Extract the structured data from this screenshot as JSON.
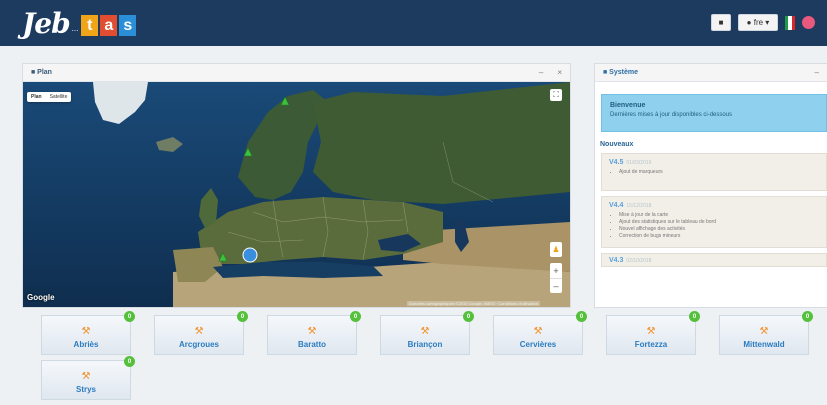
{
  "header": {
    "logo_text": "Jeb",
    "logo_dot": "...",
    "logo_tiles": [
      "t",
      "a",
      "s"
    ],
    "btn_square": "■",
    "btn_lang": "● fre ▾",
    "flag_colors": [
      "#1e9a48",
      "#ffffff",
      "#d6252b"
    ],
    "power_icon": "power-icon"
  },
  "map_panel": {
    "title": "■ Plan",
    "ctrl_minimize": "–",
    "ctrl_close": "×",
    "maptype_plan": "Plan",
    "maptype_sat": "Satellite",
    "fullscreen_icon": "⛶",
    "pegman_icon": "♟",
    "zoom_in": "+",
    "zoom_out": "–",
    "google_label": "Google",
    "attribution": "Données cartographiques ©2019 Google, INEGI · Conditions d'utilisation"
  },
  "side_panel": {
    "title": "■ Système",
    "collapse_icon": "–",
    "info_title": "Bienvenue",
    "info_text": "Dernières mises à jour disponibles ci-dessous",
    "news_title": "Nouveaux",
    "versions": [
      {
        "label": "V4.5",
        "date": "01/03/2019",
        "items": [
          "Ajout de marqueurs"
        ]
      },
      {
        "label": "V4.4",
        "date": "15/12/2018",
        "items": [
          "Mise à jour de la carte",
          "Ajout des statistiques sur le tableau de bord",
          "Nouvel affichage des activités",
          "Correction de bugs mineurs"
        ]
      },
      {
        "label": "V4.3",
        "date": "02/10/2018",
        "items": []
      }
    ]
  },
  "activities": [
    {
      "label": "Abriès",
      "badge": "0"
    },
    {
      "label": "Arcgroues",
      "badge": "0"
    },
    {
      "label": "Baratto",
      "badge": "0"
    },
    {
      "label": "Briançon",
      "badge": "0"
    },
    {
      "label": "Cervières",
      "badge": "0"
    },
    {
      "label": "Fortezza",
      "badge": "0"
    },
    {
      "label": "Mittenwald",
      "badge": "0"
    },
    {
      "label": "Strys",
      "badge": "0"
    }
  ],
  "accent_colors": {
    "header_bg": "#1d3a5f",
    "tile_orange": "#f0a418",
    "tile_red": "#e04d30",
    "tile_blue": "#2a8fd6",
    "badge_green": "#55c03c",
    "link_blue": "#2b7cc0",
    "info_blue": "#8fd0ee"
  }
}
